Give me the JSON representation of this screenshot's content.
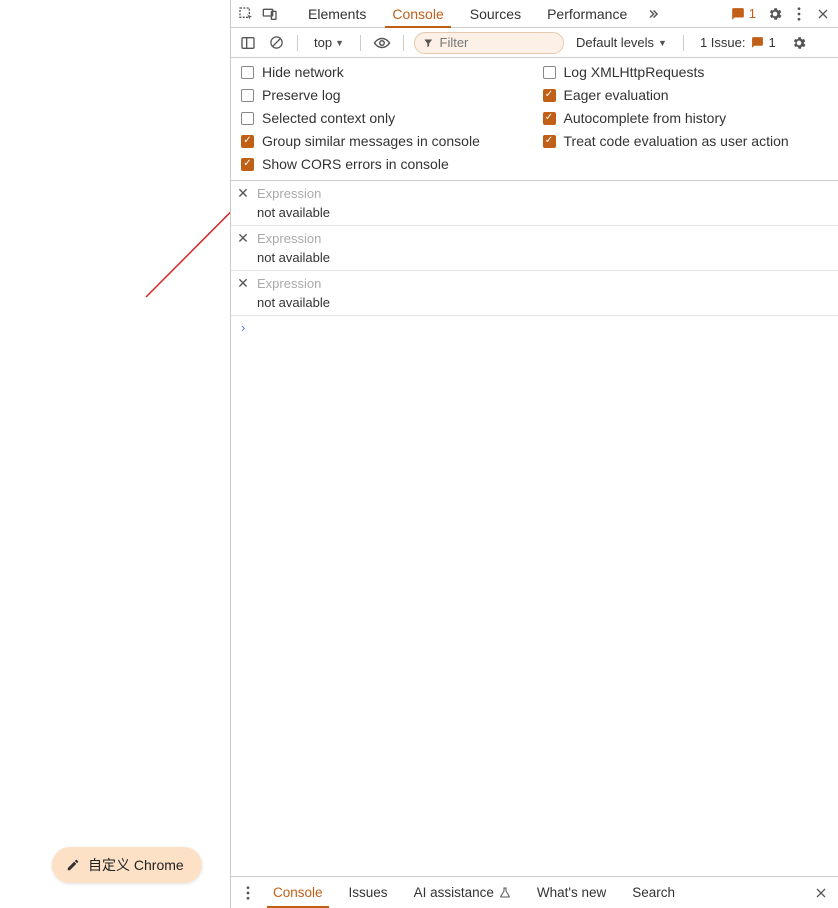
{
  "tabs": {
    "elements": "Elements",
    "console": "Console",
    "sources": "Sources",
    "performance": "Performance"
  },
  "topbar": {
    "msgCount": "1"
  },
  "toolbar": {
    "context": "top",
    "filterPlaceholder": "Filter",
    "levels": "Default levels",
    "issuesLabel": "1 Issue:",
    "issuesCount": "1"
  },
  "settings": {
    "hideNetwork": "Hide network",
    "preserveLog": "Preserve log",
    "selectedContext": "Selected context only",
    "groupSimilar": "Group similar messages in console",
    "showCors": "Show CORS errors in console",
    "logXhr": "Log XMLHttpRequests",
    "eagerEval": "Eager evaluation",
    "autocomplete": "Autocomplete from history",
    "treatEval": "Treat code evaluation as user action"
  },
  "expressions": [
    {
      "placeholder": "Expression",
      "value": "not available"
    },
    {
      "placeholder": "Expression",
      "value": "not available"
    },
    {
      "placeholder": "Expression",
      "value": "not available"
    }
  ],
  "drawer": {
    "console": "Console",
    "issues": "Issues",
    "ai": "AI assistance",
    "whatsnew": "What's new",
    "search": "Search"
  },
  "customize": "自定义 Chrome"
}
